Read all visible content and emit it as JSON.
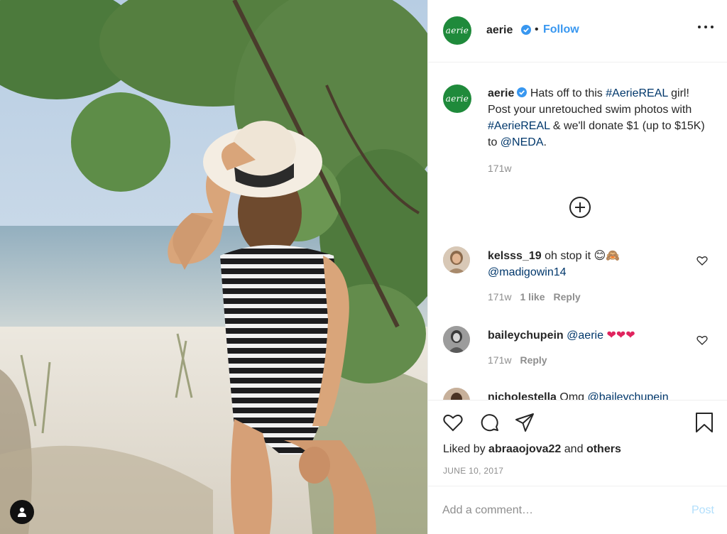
{
  "post": {
    "account": {
      "handle": "aerie",
      "logo_text": "aerie",
      "follow_label": "Follow",
      "separator": "•"
    },
    "caption": {
      "handle": "aerie",
      "parts": [
        "Hats off to this ",
        "#AerieREAL",
        " girl! Post your unretouched swim photos with ",
        "#AerieREAL",
        " & we'll donate $1 (up to $15K) to ",
        "@NEDA",
        "."
      ],
      "time": "171w"
    },
    "comments": [
      {
        "user": "kelsss_19",
        "text": "oh stop it",
        "emojis": "😊🙈",
        "mention": "@madigowin14",
        "time": "171w",
        "likes": "1 like",
        "reply_label": "Reply"
      },
      {
        "user": "baileychupein",
        "text": "",
        "mention": "@aerie",
        "emojis": "❤❤❤",
        "time": "171w",
        "reply_label": "Reply"
      },
      {
        "user": "nicholestella",
        "text": "Omg",
        "mention": "@baileychupein"
      }
    ],
    "liked_by": {
      "prefix": "Liked by",
      "user": "abraaojova22",
      "conjunction": "and",
      "others": "others"
    },
    "date": "JUNE 10, 2017",
    "comment_box": {
      "placeholder": "Add a comment…",
      "post_label": "Post"
    }
  },
  "colors": {
    "brand_green": "#1f8a3b",
    "link_blue": "#3897f0",
    "text": "#262626",
    "muted": "#8e8e8e",
    "post_disabled": "#b2dffc"
  },
  "icons": [
    "user-tag-icon",
    "verified-badge-icon",
    "more-options-icon",
    "load-more-plus-icon",
    "heart-icon",
    "comment-icon",
    "share-icon",
    "bookmark-icon"
  ]
}
